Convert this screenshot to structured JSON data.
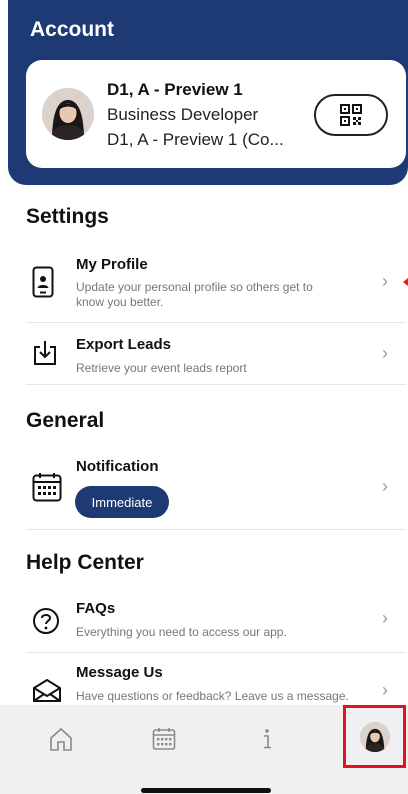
{
  "header": {
    "title": "Account",
    "profile": {
      "name": "D1, A - Preview 1",
      "role": "Business Developer",
      "company": "D1, A - Preview 1 (Co..."
    },
    "qr_icon": "qr-code-icon"
  },
  "settings": {
    "title": "Settings",
    "items": [
      {
        "title": "My Profile",
        "description": "Update your personal profile so others get to know you better.",
        "icon": "phone-profile-icon"
      },
      {
        "title": "Export Leads",
        "description": "Retrieve your event leads report",
        "icon": "download-icon"
      }
    ]
  },
  "general": {
    "title": "General",
    "items": [
      {
        "title": "Notification",
        "value": "Immediate",
        "icon": "calendar-icon"
      }
    ]
  },
  "help": {
    "title": "Help Center",
    "items": [
      {
        "title": "FAQs",
        "description": "Everything you need to access our app.",
        "icon": "question-circle-icon"
      },
      {
        "title": "Message Us",
        "description": "Have questions or feedback? Leave us a message.",
        "icon": "envelope-icon"
      }
    ]
  },
  "bottom_nav": {
    "items": [
      "home-icon",
      "calendar-icon",
      "info-icon",
      "avatar"
    ],
    "active": "avatar"
  },
  "colors": {
    "primary": "#1e3a74",
    "highlight": "#e8101e"
  }
}
